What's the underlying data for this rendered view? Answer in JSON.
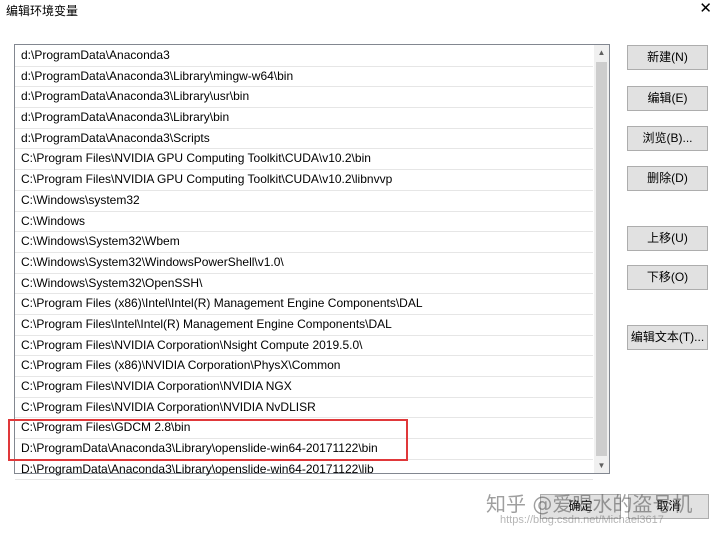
{
  "window": {
    "title": "编辑环境变量",
    "close_glyph": "✕"
  },
  "path_list": {
    "items": [
      "d:\\ProgramData\\Anaconda3",
      "d:\\ProgramData\\Anaconda3\\Library\\mingw-w64\\bin",
      "d:\\ProgramData\\Anaconda3\\Library\\usr\\bin",
      "d:\\ProgramData\\Anaconda3\\Library\\bin",
      "d:\\ProgramData\\Anaconda3\\Scripts",
      "C:\\Program Files\\NVIDIA GPU Computing Toolkit\\CUDA\\v10.2\\bin",
      "C:\\Program Files\\NVIDIA GPU Computing Toolkit\\CUDA\\v10.2\\libnvvp",
      "C:\\Windows\\system32",
      "C:\\Windows",
      "C:\\Windows\\System32\\Wbem",
      "C:\\Windows\\System32\\WindowsPowerShell\\v1.0\\",
      "C:\\Windows\\System32\\OpenSSH\\",
      "C:\\Program Files (x86)\\Intel\\Intel(R) Management Engine Components\\DAL",
      "C:\\Program Files\\Intel\\Intel(R) Management Engine Components\\DAL",
      "C:\\Program Files\\NVIDIA Corporation\\Nsight Compute 2019.5.0\\",
      "C:\\Program Files (x86)\\NVIDIA Corporation\\PhysX\\Common",
      "C:\\Program Files\\NVIDIA Corporation\\NVIDIA NGX",
      "C:\\Program Files\\NVIDIA Corporation\\NVIDIA NvDLISR",
      "C:\\Program Files\\GDCM 2.8\\bin",
      "D:\\ProgramData\\Anaconda3\\Library\\openslide-win64-20171122\\bin",
      "D:\\ProgramData\\Anaconda3\\Library\\openslide-win64-20171122\\lib"
    ],
    "scroll_up_glyph": "▲",
    "scroll_down_glyph": "▼"
  },
  "buttons": {
    "new": "新建(N)",
    "edit": "编辑(E)",
    "browse": "浏览(B)...",
    "delete": "删除(D)",
    "move_up": "上移(U)",
    "move_down": "下移(O)",
    "edit_text": "编辑文本(T)..."
  },
  "footer": {
    "ok": "确定",
    "cancel": "取消"
  },
  "watermark": {
    "text": "知乎 @爱喝水的盗号机",
    "url": "https://blog.csdn.net/Michael3617"
  },
  "colors": {
    "highlight_border": "#e0383a",
    "button_bg": "#e1e1e1",
    "list_border": "#828790"
  }
}
